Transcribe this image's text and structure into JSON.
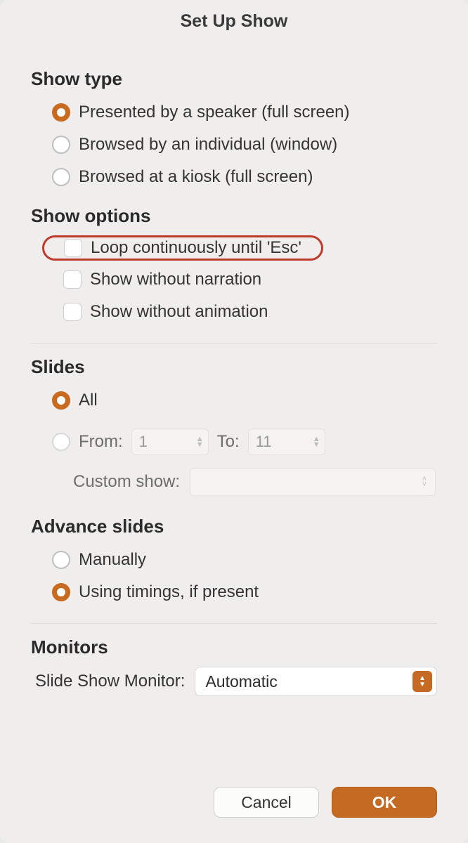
{
  "dialog": {
    "title": "Set Up Show",
    "sections": {
      "show_type": {
        "heading": "Show type",
        "opt_speaker": "Presented by a speaker (full screen)",
        "opt_individual": "Browsed by an individual (window)",
        "opt_kiosk": "Browsed at a kiosk (full screen)"
      },
      "show_options": {
        "heading": "Show options",
        "opt_loop": "Loop continuously until 'Esc'",
        "opt_no_narration": "Show without narration",
        "opt_no_animation": "Show without animation"
      },
      "slides": {
        "heading": "Slides",
        "opt_all": "All",
        "from_label": "From:",
        "from_value": "1",
        "to_label": "To:",
        "to_value": "11",
        "custom_label": "Custom show:"
      },
      "advance": {
        "heading": "Advance slides",
        "opt_manually": "Manually",
        "opt_timings": "Using timings, if present"
      },
      "monitors": {
        "heading": "Monitors",
        "label": "Slide Show Monitor:",
        "value": "Automatic"
      }
    },
    "buttons": {
      "cancel": "Cancel",
      "ok": "OK"
    }
  }
}
